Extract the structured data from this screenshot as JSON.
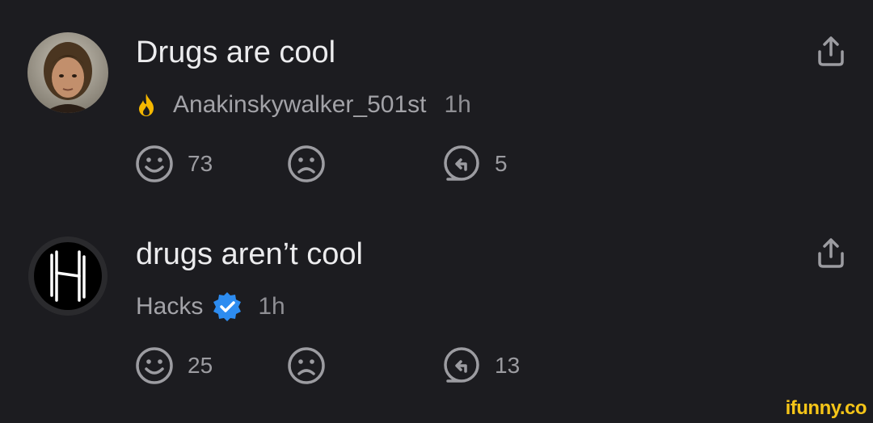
{
  "comments": [
    {
      "text": "Drugs are cool",
      "username": "Anakinskywalker_501st",
      "time": "1h",
      "badge": "flame-icon",
      "likes": "73",
      "replies": "5"
    },
    {
      "text": "drugs aren’t cool",
      "username": "Hacks",
      "time": "1h",
      "badge": "verified-badge-icon",
      "likes": "25",
      "replies": "13"
    }
  ],
  "watermark": "ifunny.co",
  "colors": {
    "background": "#1c1c20",
    "flame": "#f5b700",
    "verified": "#2d8cf0",
    "icon_gray": "#9c9ca1",
    "watermark": "#f5c518"
  }
}
